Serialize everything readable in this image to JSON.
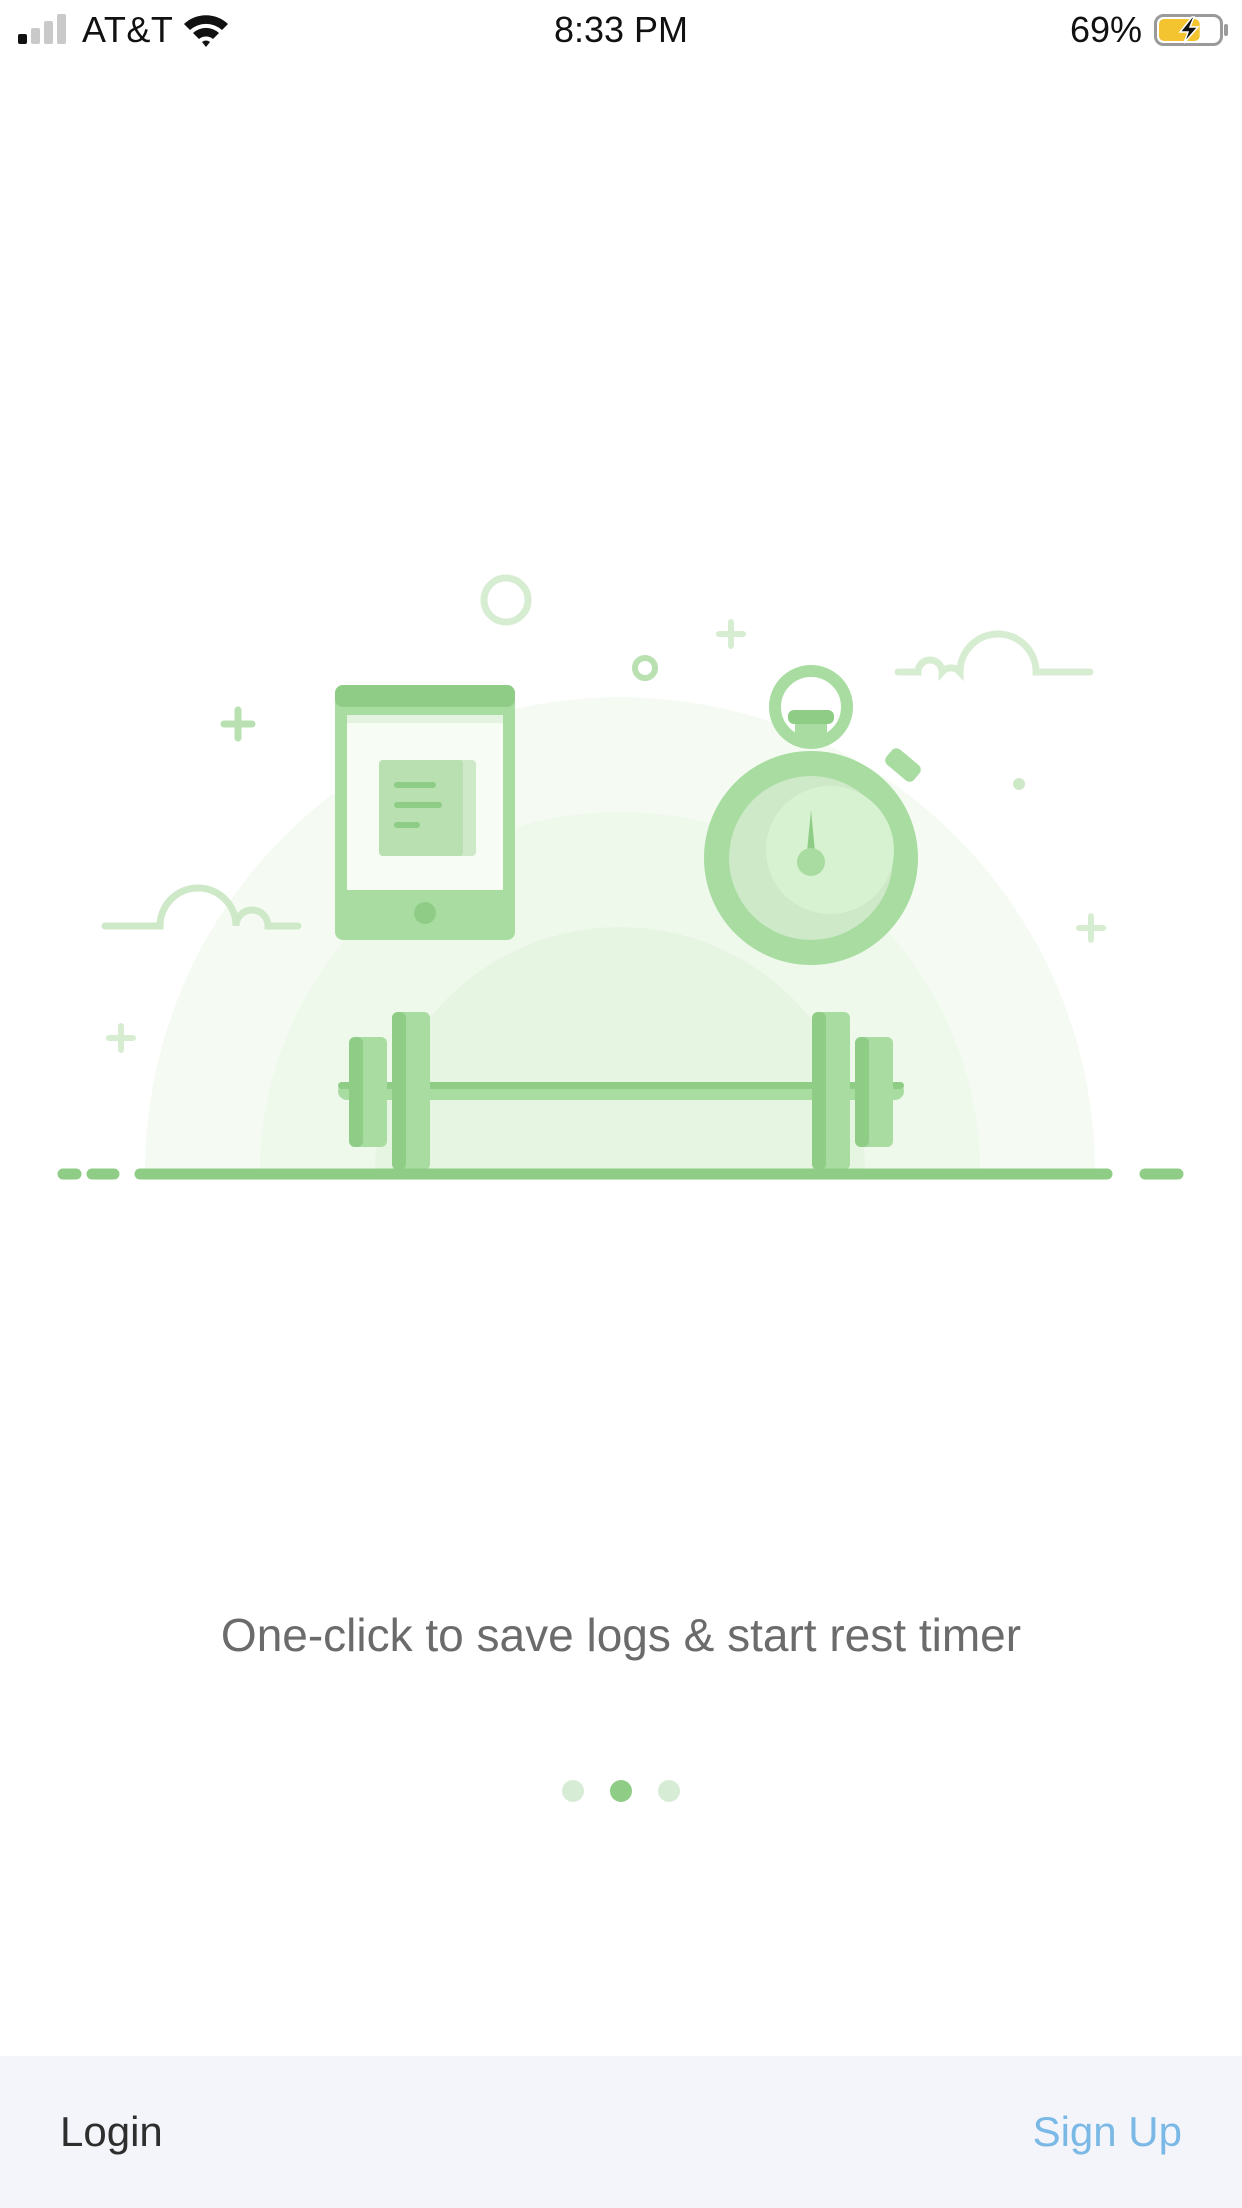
{
  "status_bar": {
    "carrier": "AT&T",
    "time": "8:33 PM",
    "battery_percent": "69%",
    "battery_level": 0.69,
    "signal_bars_active": 1,
    "signal_bars_total": 4,
    "icons": [
      "signal-icon",
      "wifi-icon",
      "battery-charging-icon"
    ]
  },
  "onboarding": {
    "illustration": "tablet-stopwatch-barbell-illustration",
    "caption": "One-click to save logs & start rest timer",
    "page_count": 3,
    "current_page": 2
  },
  "bottom_bar": {
    "login_label": "Login",
    "signup_label": "Sign Up"
  },
  "colors": {
    "accent_green": "#8fcd87",
    "signup_blue": "#7ab8e6",
    "bottom_bar_bg": "#f4f5fb",
    "battery_yellow": "#f4c430"
  }
}
